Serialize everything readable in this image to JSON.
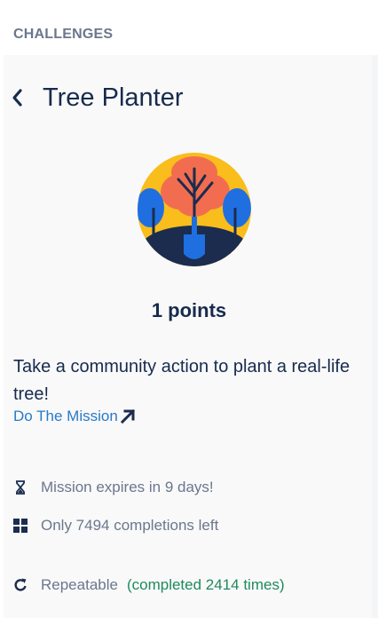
{
  "header": {
    "section_title": "CHALLENGES"
  },
  "challenge": {
    "title": "Tree Planter",
    "points": "1 points",
    "description": "Take a community action to plant a real-life tree!",
    "mission_link": "Do The Mission",
    "expires": "Mission expires in 9 days!",
    "completions_left": "Only 7494 completions left",
    "repeatable": "Repeatable",
    "completed_times": "(completed 2414 times)"
  },
  "icons": {
    "back": "chevron-left-icon",
    "external": "arrow-up-right-icon",
    "expires": "hourglass-icon",
    "completions": "grid-icon",
    "repeatable": "refresh-icon"
  },
  "colors": {
    "text": "#172b4d",
    "muted": "#6b778c",
    "link": "#2979c8",
    "success": "#1e8b5b",
    "badge_sun": "#f9bd1c",
    "badge_tree_top": "#f26d4f",
    "badge_side_trees": "#1f6fe0",
    "badge_ground": "#1b2c4f"
  }
}
